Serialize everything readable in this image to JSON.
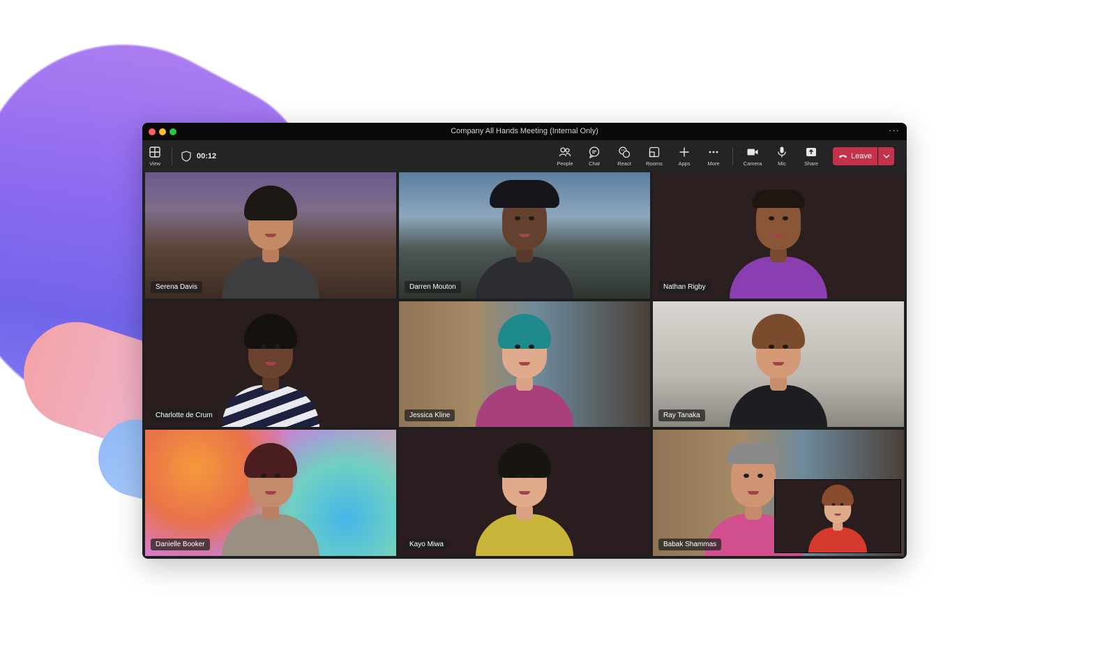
{
  "window": {
    "title": "Company All Hands Meeting (Internal Only)",
    "more_glyph": "···"
  },
  "toolbar": {
    "view_label": "View",
    "timer": "00:12",
    "people_label": "People",
    "chat_label": "Chat",
    "react_label": "React",
    "rooms_label": "Rooms",
    "apps_label": "Apps",
    "more_label": "More",
    "camera_label": "Camera",
    "mic_label": "Mic",
    "share_label": "Share",
    "leave_label": "Leave"
  },
  "participants": [
    {
      "name": "Serena Davis"
    },
    {
      "name": "Darren Mouton"
    },
    {
      "name": "Nathan Rigby"
    },
    {
      "name": "Charlotte de Crum"
    },
    {
      "name": "Jessica Kline"
    },
    {
      "name": "Ray Tanaka"
    },
    {
      "name": "Danielle Booker"
    },
    {
      "name": "Kayo Miwa"
    },
    {
      "name": "Babak Shammas"
    }
  ],
  "colors": {
    "leave": "#c4314b",
    "window_bg": "#1f1f1f",
    "toolbar_bg": "#242424"
  },
  "icons": {
    "view": "grid-view-icon",
    "shield": "shield-icon",
    "people": "people-icon",
    "chat": "chat-icon",
    "react": "react-icon",
    "rooms": "rooms-icon",
    "apps": "plus-icon",
    "more": "ellipsis-icon",
    "camera": "camera-icon",
    "mic": "mic-icon",
    "share": "share-icon",
    "leave": "phone-hangup-icon",
    "leave_caret": "chevron-down-icon"
  }
}
